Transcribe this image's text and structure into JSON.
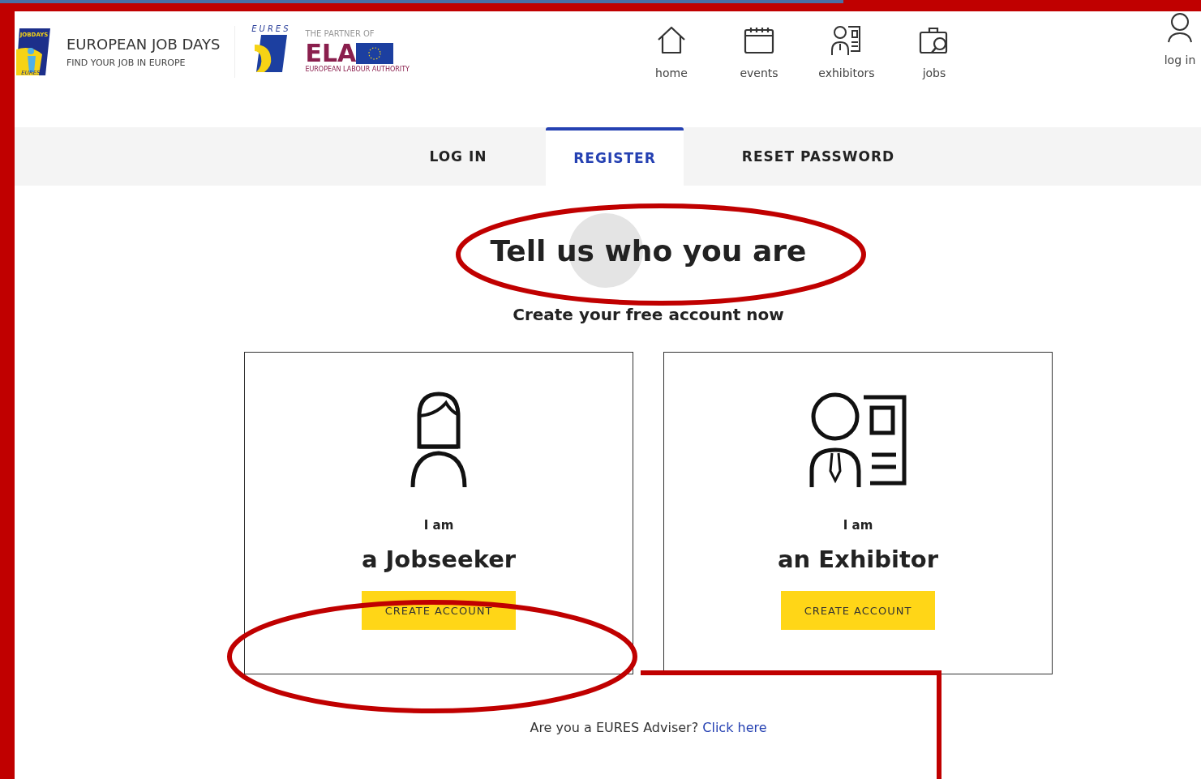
{
  "header": {
    "brand": {
      "logo_top": "JOBDAYS",
      "logo_bottom": "EURES",
      "title": "EUROPEAN JOB DAYS",
      "tagline": "FIND YOUR JOB IN EUROPE"
    },
    "partner": {
      "eures_text": "EURES",
      "caption": "THE PARTNER OF",
      "ela": "ELA",
      "ela_subtitle": "EUROPEAN LABOUR AUTHORITY"
    },
    "nav": [
      {
        "kind": "home",
        "label": "home"
      },
      {
        "kind": "events",
        "label": "events"
      },
      {
        "kind": "exhibitors",
        "label": "exhibitors"
      },
      {
        "kind": "jobs",
        "label": "jobs"
      }
    ],
    "login": {
      "label": "log in"
    }
  },
  "tabs": [
    {
      "label": "LOG IN",
      "selected": false
    },
    {
      "label": "REGISTER",
      "selected": true
    },
    {
      "label": "RESET PASSWORD",
      "selected": false
    }
  ],
  "heading": "Tell us who you are",
  "subheading": "Create your free account now",
  "cards": [
    {
      "kind": "jobseeker",
      "prefix": "I am",
      "title": "a Jobseeker",
      "button": "CREATE ACCOUNT"
    },
    {
      "kind": "exhibitor",
      "prefix": "I am",
      "title": "an Exhibitor",
      "button": "CREATE ACCOUNT"
    }
  ],
  "footer": {
    "text": "Are you a EURES Adviser?",
    "link": "Click here"
  }
}
